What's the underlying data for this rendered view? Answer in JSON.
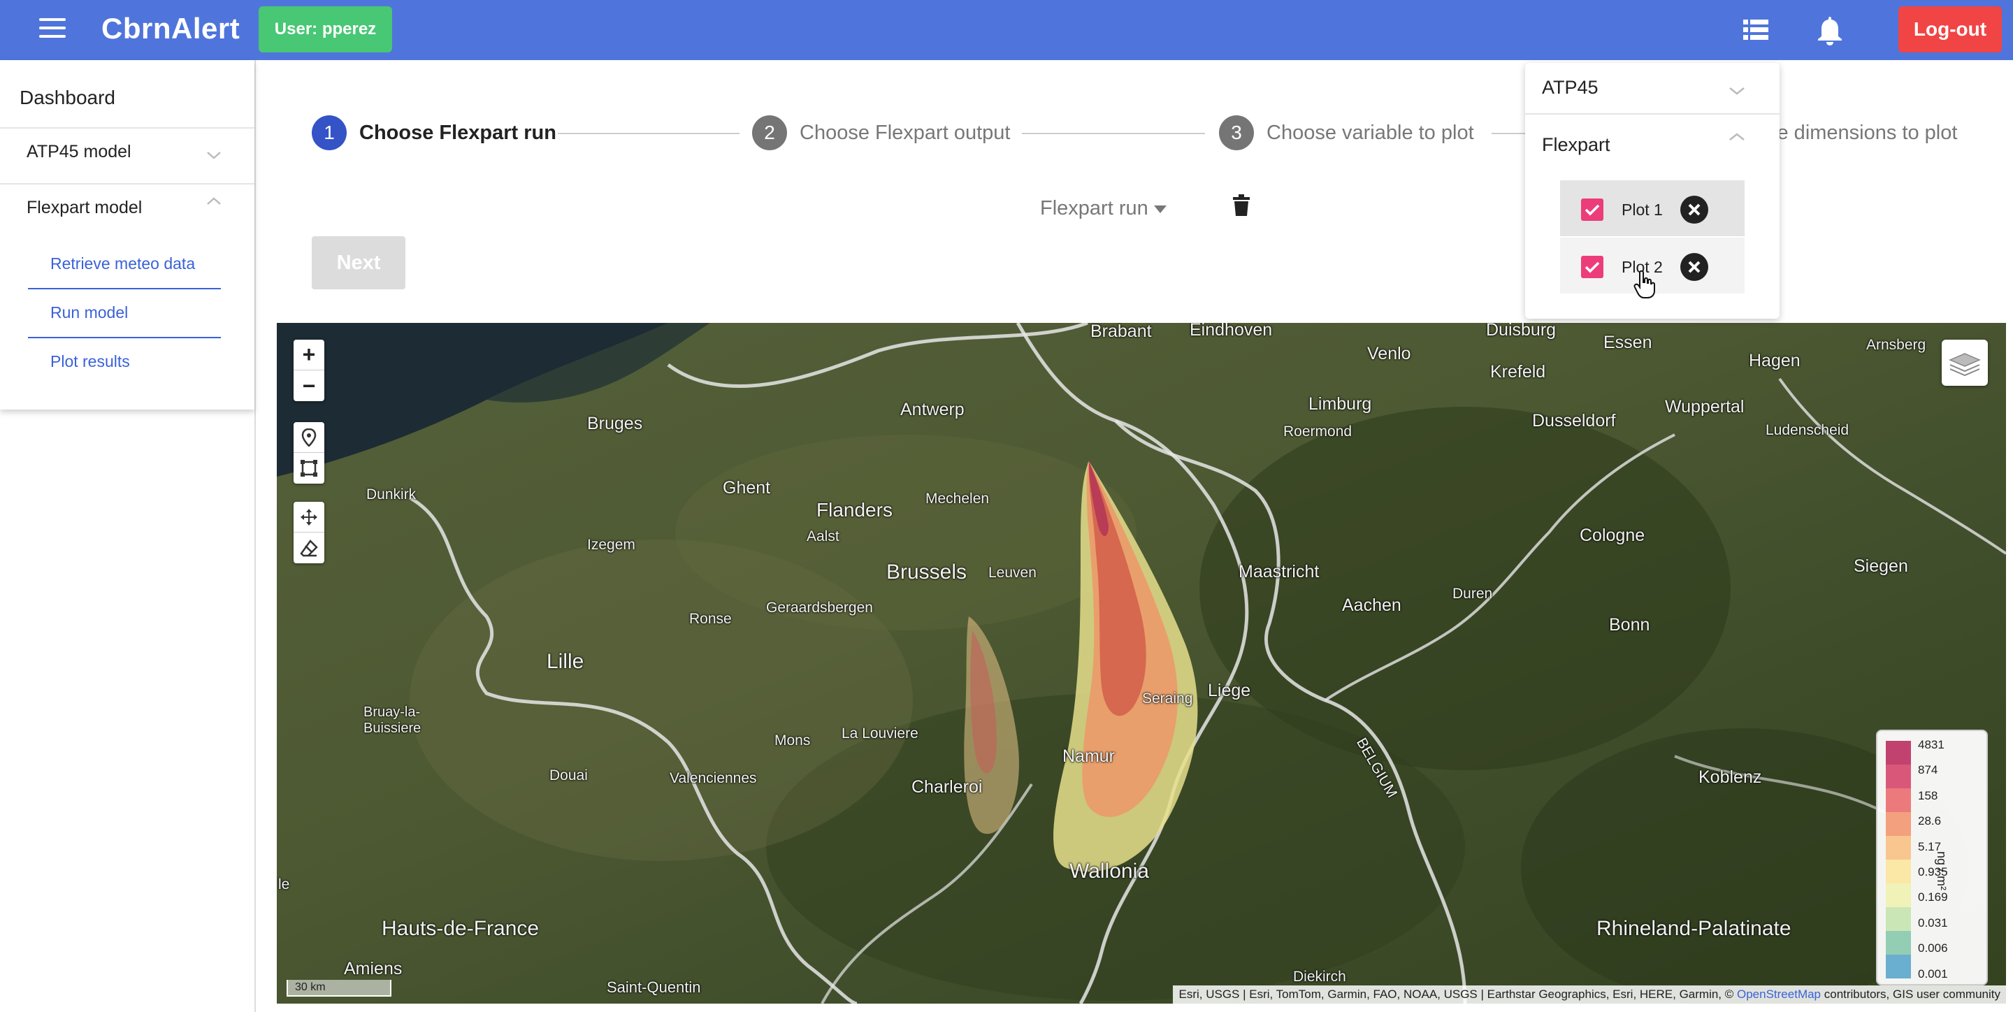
{
  "header": {
    "app_title": "CbrnAlert",
    "user_badge": "User: pperez",
    "logout_label": "Log-out"
  },
  "sidebar": {
    "title": "Dashboard",
    "items": [
      {
        "label": "ATP45 model"
      },
      {
        "label": "Flexpart model"
      }
    ],
    "subitems": [
      {
        "label": "Retrieve meteo data"
      },
      {
        "label": "Run model"
      },
      {
        "label": "Plot results"
      }
    ]
  },
  "stepper": {
    "steps": [
      {
        "number": "1",
        "label": "Choose Flexpart run"
      },
      {
        "number": "2",
        "label": "Choose Flexpart output"
      },
      {
        "number": "3",
        "label": "Choose variable to plot"
      },
      {
        "label": "se dimensions to plot"
      }
    ]
  },
  "form": {
    "run_dropdown": "Flexpart run",
    "next_label": "Next"
  },
  "dropdown_panel": {
    "atp45_label": "ATP45",
    "flexpart_label": "Flexpart",
    "plots": [
      {
        "label": "Plot 1",
        "checked": true
      },
      {
        "label": "Plot 2",
        "checked": true
      }
    ]
  },
  "map": {
    "zoom_in": "+",
    "zoom_out": "−",
    "scale": "30 km",
    "attribution": "Esri, USGS | Esri, TomTom, Garmin, FAO, NOAA, USGS | Earthstar Geographics, Esri, HERE, Garmin, © ",
    "attribution_link": "OpenStreetMap",
    "attribution_tail": " contributors, GIS user community",
    "places": [
      "Brabant",
      "Eindhoven",
      "Venlo",
      "Duisburg",
      "Essen",
      "Arnsberg",
      "Krefeld",
      "Hagen",
      "Limburg",
      "Wuppertal",
      "Dusseldorf",
      "Ludenscheid",
      "Bruges",
      "Antwerp",
      "Roermond",
      "Dunkirk",
      "Ghent",
      "Mechelen",
      "Flanders",
      "Aalst",
      "Izegem",
      "Brussels",
      "Leuven",
      "Maastricht",
      "Cologne",
      "Siegen",
      "Aachen",
      "Duren",
      "Geraardsbergen",
      "Ronse",
      "Bonn",
      "Lille",
      "Seraing",
      "Liege",
      "Bruay-la-\nBuissiere",
      "Mons",
      "La Louviere",
      "Namur",
      "Valenciennes",
      "Douai",
      "Charleroi",
      "Koblenz",
      "Wallonia",
      "Hauts-de-France",
      "Rhineland-Palatinate",
      "Amiens",
      "Saint-Quentin",
      "Diekirch",
      "BELGIUM",
      "le"
    ]
  },
  "legend": {
    "unit": "ng / m²",
    "entries": [
      {
        "label": "4831",
        "color": "#c1426f"
      },
      {
        "label": "874",
        "color": "#d9587a"
      },
      {
        "label": "158",
        "color": "#ec7a7c"
      },
      {
        "label": "28.6",
        "color": "#f3a07e"
      },
      {
        "label": "5.17",
        "color": "#f9c690"
      },
      {
        "label": "0.935",
        "color": "#fbe7a6"
      },
      {
        "label": "0.169",
        "color": "#f0f2b8"
      },
      {
        "label": "0.031",
        "color": "#cbe6b6"
      },
      {
        "label": "0.006",
        "color": "#93cdb4"
      },
      {
        "label": "0.001",
        "color": "#6aaed0"
      }
    ]
  },
  "colors": {
    "topbar": "#4f75dc",
    "user_badge": "#48c774",
    "logout": "#f14444",
    "step_active": "#3453c7",
    "checkbox": "#ec3d7a",
    "link": "#3a62d8"
  }
}
